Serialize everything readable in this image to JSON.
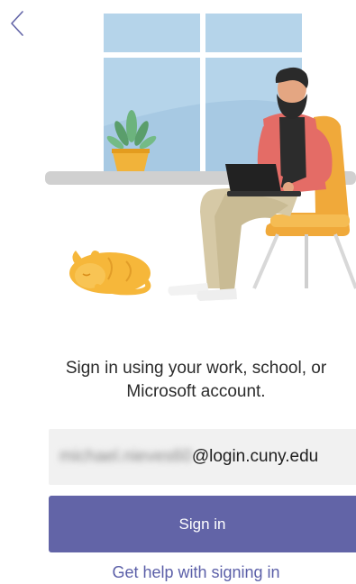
{
  "nav": {
    "back_icon": "chevron-left-icon"
  },
  "illustration": {
    "description_icon": "person-working-on-laptop-with-cat-icon"
  },
  "signin": {
    "heading": "Sign in using your work, school, or Microsoft account.",
    "email_user": "michael.nieves60",
    "email_domain": "@login.cuny.edu",
    "button_label": "Sign in",
    "help_link": "Get help with signing in"
  },
  "colors": {
    "accent": "#6264a7",
    "link": "#5b5fa8",
    "field_bg": "#f1f1f1"
  }
}
